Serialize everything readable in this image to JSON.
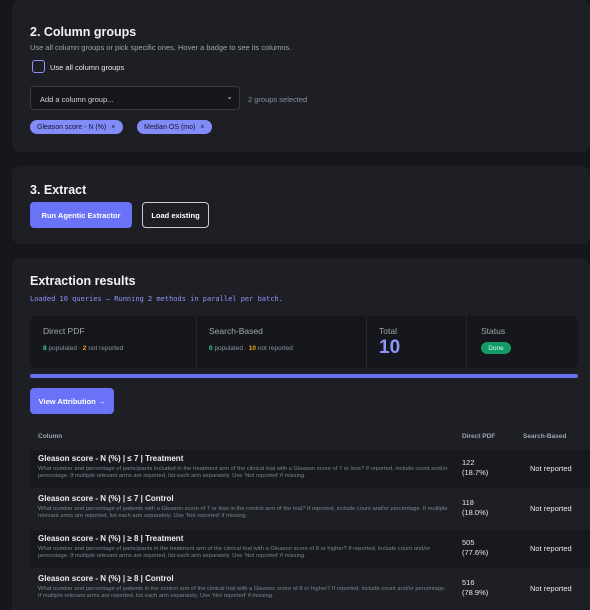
{
  "column_groups": {
    "title": "2. Column groups",
    "subtitle": "Use all column groups or pick specific ones. Hover a badge to see its columns.",
    "use_all_label": "Use all column groups",
    "select_placeholder": "Add a column group...",
    "chevron": "⌄",
    "selected_count": "2 groups selected",
    "badges": [
      {
        "label": "Gleason score - N (%)",
        "remove": "×"
      },
      {
        "label": "Median OS (mo)",
        "remove": "×"
      }
    ]
  },
  "extract": {
    "title": "3. Extract",
    "run_label": "Run Agentic Extractor",
    "load_label": "Load existing"
  },
  "results": {
    "title": "Extraction results",
    "status_line": "Loaded 10 queries — Running 2 methods in parallel per batch.",
    "stats": {
      "direct": {
        "title": "Direct PDF",
        "populated": "8",
        "populated_label": "populated ·",
        "not_reported": "2",
        "not_reported_label": "not reported"
      },
      "search": {
        "title": "Search-Based",
        "populated": "0",
        "populated_label": "populated ·",
        "not_reported": "10",
        "not_reported_label": "not reported"
      },
      "total": {
        "title": "Total",
        "value": "10"
      },
      "status": {
        "title": "Status",
        "badge": "Done"
      }
    },
    "progress": 1.0,
    "view_label": "View Attribution →",
    "columns": [
      "Column",
      "Direct PDF",
      "Search-Based"
    ],
    "rows": [
      {
        "title": "Gleason score - N (%) | ≤ 7 | Treatment",
        "desc": "What number and percentage of participants included in the treatment arm of the clinical trial with a Gleason score of 7 or less? If reported, include count and/or percentage. If multiple relevant arms are reported, list each arm separately. Use 'Not reported' if missing.",
        "direct": "122",
        "direct_pct": "(18.7%)",
        "search": "Not reported"
      },
      {
        "title": "Gleason score - N (%) | ≤ 7 | Control",
        "desc": "What number and percentage of patients with a Gleason score of 7 or less in the control arm of the trial? If reported, include count and/or percentage. If multiple relevant arms are reported, list each arm separately. Use 'Not reported' if missing.",
        "direct": "118",
        "direct_pct": "(18.0%)",
        "search": "Not reported"
      },
      {
        "title": "Gleason score - N (%) | ≥ 8 | Treatment",
        "desc": "What number and percentage of participants in the treatment arm of the clinical trial with a Gleason score of 8 or higher? If reported, include count and/or percentage. If multiple relevant arms are reported, list each arm separately. Use 'Not reported' if missing.",
        "direct": "505",
        "direct_pct": "(77.6%)",
        "search": "Not reported"
      },
      {
        "title": "Gleason score - N (%) | ≥ 8 | Control",
        "desc": "What number and percentage of patients in the control arm of the clinical trial with a Gleason score of 8 or higher? If reported, include count and/or percentage. If multiple relevant arms are reported, list each arm separately. Use 'Not reported' if missing.",
        "direct": "516",
        "direct_pct": "(78.9%)",
        "search": "Not reported"
      }
    ]
  }
}
